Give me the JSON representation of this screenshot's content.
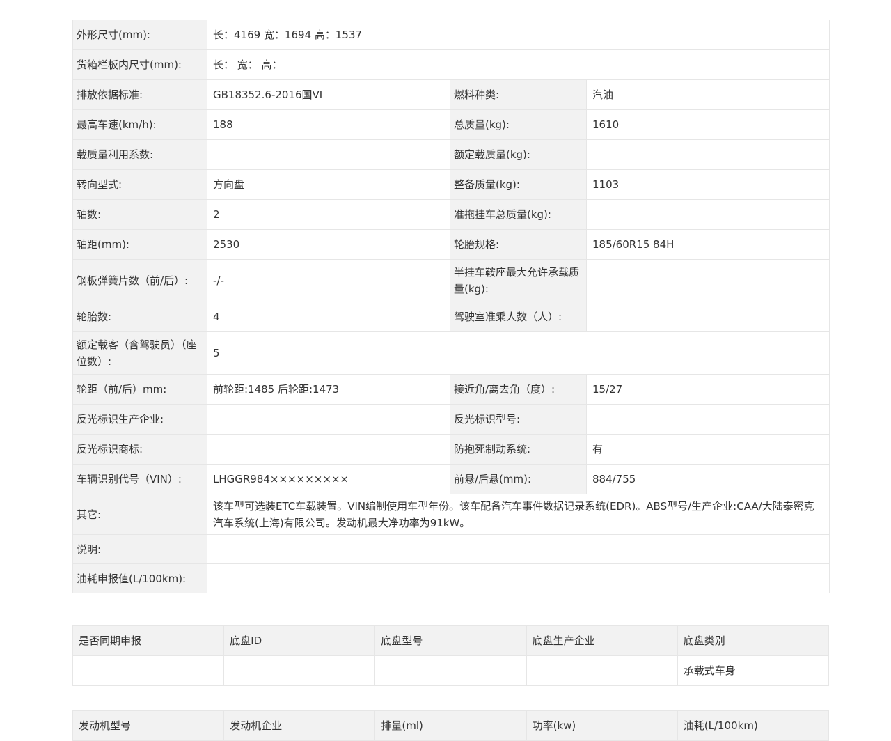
{
  "spec": {
    "dimensions": {
      "label": "外形尺寸(mm):",
      "value": "长：4169 宽：1694 高：1537"
    },
    "cargo_box": {
      "label": "货箱栏板内尺寸(mm):",
      "value": "长：  宽：  高："
    },
    "rows": [
      {
        "l1": "排放依据标准:",
        "v1": "GB18352.6-2016国VI",
        "l2": "燃料种类:",
        "v2": "汽油"
      },
      {
        "l1": "最高车速(km/h):",
        "v1": "188",
        "l2": "总质量(kg):",
        "v2": "1610"
      },
      {
        "l1": "载质量利用系数:",
        "v1": "",
        "l2": "额定载质量(kg):",
        "v2": ""
      },
      {
        "l1": "转向型式:",
        "v1": "方向盘",
        "l2": "整备质量(kg):",
        "v2": "1103"
      },
      {
        "l1": "轴数:",
        "v1": "2",
        "l2": "准拖挂车总质量(kg):",
        "v2": ""
      },
      {
        "l1": "轴距(mm):",
        "v1": "2530",
        "l2": "轮胎规格:",
        "v2": "185/60R15 84H"
      },
      {
        "l1": "钢板弹簧片数（前/后）:",
        "v1": "-/-",
        "l2": "半挂车鞍座最大允许承载质量(kg):",
        "v2": ""
      },
      {
        "l1": "轮胎数:",
        "v1": "4",
        "l2": "驾驶室准乘人数（人）:",
        "v2": ""
      }
    ],
    "seats": {
      "label": "额定载客（含驾驶员）（座位数）:",
      "value": "5"
    },
    "rows2": [
      {
        "l1": "轮距（前/后）mm:",
        "v1": "前轮距:1485 后轮距:1473",
        "l2": "接近角/离去角（度）:",
        "v2": "15/27"
      },
      {
        "l1": "反光标识生产企业:",
        "v1": "",
        "l2": "反光标识型号:",
        "v2": ""
      },
      {
        "l1": "反光标识商标:",
        "v1": "",
        "l2": "防抱死制动系统:",
        "v2": "有"
      },
      {
        "l1": "车辆识别代号（VIN）:",
        "v1": "LHGGR984×××××××××",
        "l2": "前悬/后悬(mm):",
        "v2": "884/755"
      }
    ],
    "other": {
      "label": "其它:",
      "value": "该车型可选装ETC车载装置。VIN编制使用车型年份。该车配备汽车事件数据记录系统(EDR)。ABS型号/生产企业:CAA/大陆泰密克汽车系统(上海)有限公司。发动机最大净功率为91kW。"
    },
    "note": {
      "label": "说明:",
      "value": ""
    },
    "fuel": {
      "label": "油耗申报值(L/100km):",
      "value": ""
    }
  },
  "chassis": {
    "headers": [
      "是否同期申报",
      "底盘ID",
      "底盘型号",
      "底盘生产企业",
      "底盘类别"
    ],
    "row": [
      "",
      "",
      "",
      "",
      "承载式车身"
    ]
  },
  "engine": {
    "headers": [
      "发动机型号",
      "发动机企业",
      "排量(ml)",
      "功率(kw)",
      "油耗(L/100km)"
    ]
  }
}
